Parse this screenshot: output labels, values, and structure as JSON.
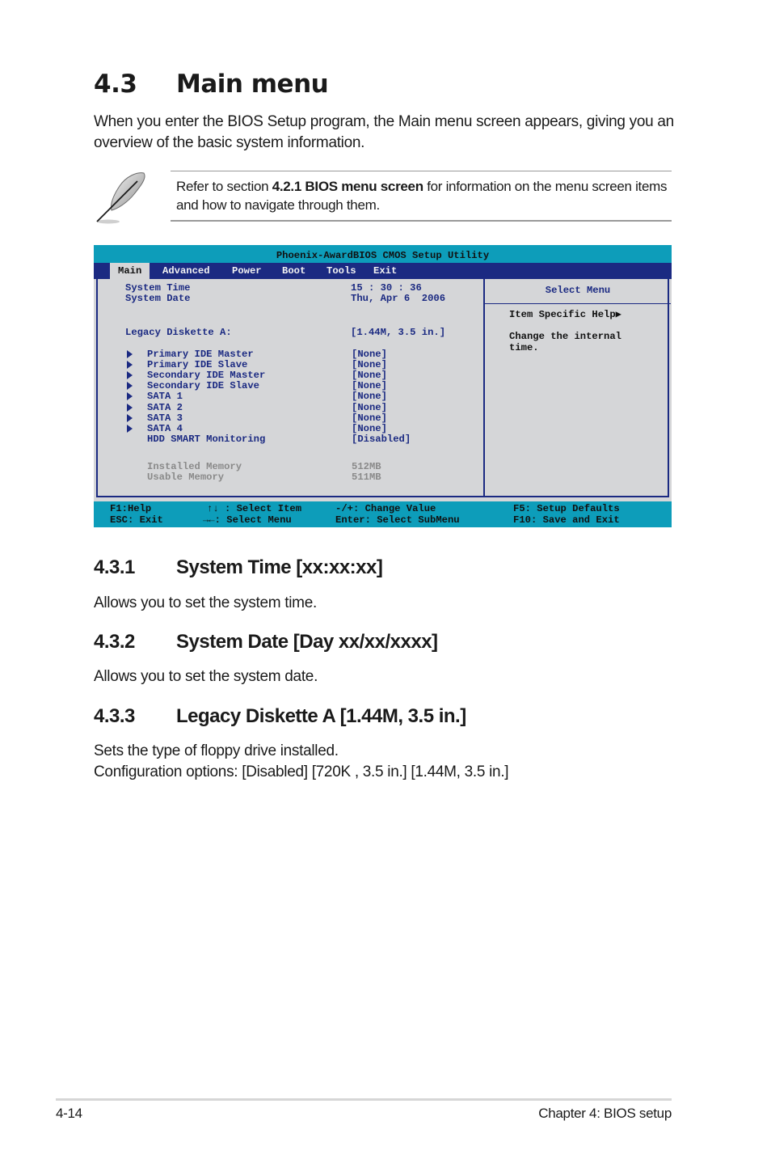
{
  "section": {
    "number": "4.3",
    "title": "Main menu",
    "intro": "When you enter the BIOS Setup program, the Main menu screen appears, giving you an overview of the basic system information."
  },
  "note": {
    "icon": "feather-note-icon",
    "text_before": "Refer to section ",
    "text_bold": "4.2.1 BIOS menu screen",
    "text_after": " for information on the menu screen items and how to navigate through them."
  },
  "bios": {
    "title": "Phoenix-AwardBIOS CMOS Setup Utility",
    "colors": {
      "title_bar": "#0d9dba",
      "menu_bar": "#1b2a82",
      "body": "#d5d6d8",
      "item_text": "#1b2a82",
      "info_text": "#8a8a8a"
    },
    "tabs": [
      {
        "label": "Main",
        "active": true
      },
      {
        "label": "Advanced",
        "active": false
      },
      {
        "label": "Power",
        "active": false
      },
      {
        "label": "Boot",
        "active": false
      },
      {
        "label": "Tools",
        "active": false
      },
      {
        "label": "Exit",
        "active": false
      }
    ],
    "items": [
      {
        "label": "System Time",
        "value": "15 : 30 : 36"
      },
      {
        "label": "System Date",
        "value": "Thu, Apr 6  2006"
      },
      {
        "label": "Legacy Diskette A:",
        "value": "[1.44M, 3.5 in.]"
      },
      {
        "label": "Primary IDE Master",
        "value": "[None]",
        "submenu": true
      },
      {
        "label": "Primary IDE Slave",
        "value": "[None]",
        "submenu": true
      },
      {
        "label": "Secondary IDE Master",
        "value": "[None]",
        "submenu": true
      },
      {
        "label": "Secondary IDE Slave",
        "value": "[None]",
        "submenu": true
      },
      {
        "label": "SATA 1",
        "value": "[None]",
        "submenu": true
      },
      {
        "label": "SATA 2",
        "value": "[None]",
        "submenu": true
      },
      {
        "label": "SATA 3",
        "value": "[None]",
        "submenu": true
      },
      {
        "label": "SATA 4",
        "value": "[None]",
        "submenu": true
      },
      {
        "label": "HDD SMART Monitoring",
        "value": "[Disabled]"
      },
      {
        "label": "Installed Memory",
        "value": "512MB"
      },
      {
        "label": "Usable Memory",
        "value": "511MB"
      }
    ],
    "help": {
      "header": "Select Menu",
      "title": "Item Specific Help▶",
      "line1": "Change the internal",
      "line2": "time."
    },
    "footer": {
      "f1": "F1:Help",
      "esc": "ESC: Exit",
      "updown": "↑↓ : Select Item",
      "leftright": "→←: Select Menu",
      "change": "-/+: Change Value",
      "enter": "Enter: Select SubMenu",
      "f5": "F5: Setup Defaults",
      "f10": "F10: Save and Exit"
    }
  },
  "subsections": [
    {
      "number": "4.3.1",
      "title": "System Time [xx:xx:xx]",
      "body": [
        "Allows you to set the system time."
      ]
    },
    {
      "number": "4.3.2",
      "title": "System Date [Day xx/xx/xxxx]",
      "body": [
        "Allows you to set the system date."
      ]
    },
    {
      "number": "4.3.3",
      "title": "Legacy Diskette A [1.44M, 3.5 in.]",
      "body": [
        "Sets the type of floppy drive installed.",
        "Configuration options: [Disabled] [720K , 3.5 in.] [1.44M, 3.5 in.]"
      ]
    }
  ],
  "page_footer": {
    "page_number": "4-14",
    "chapter": "Chapter 4: BIOS setup"
  }
}
